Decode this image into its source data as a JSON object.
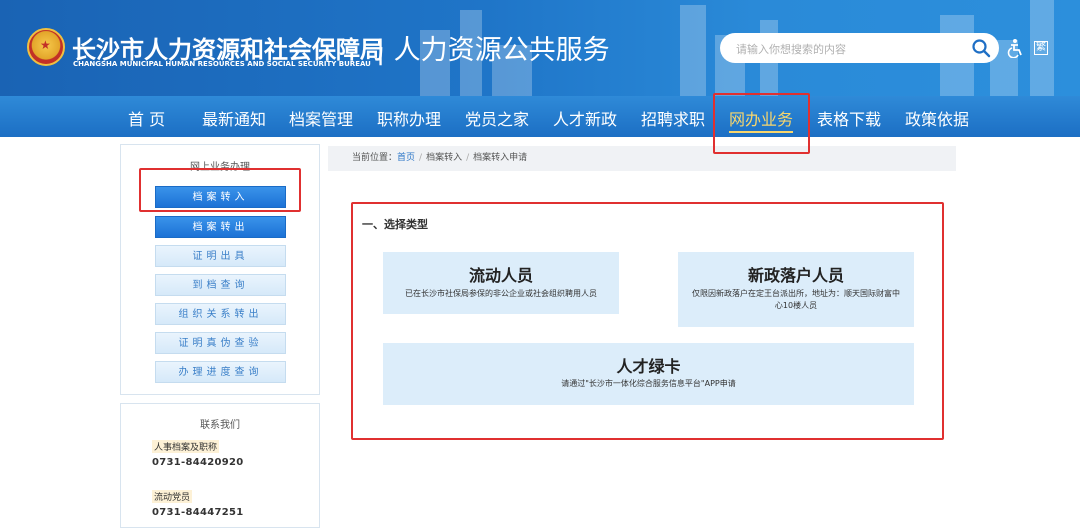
{
  "header": {
    "logo_cn": "长沙市人力资源和社会保障局",
    "logo_en": "CHANGSHA MUNICIPAL HUMAN RESOURCES AND SOCIAL SECURITY BUREAU",
    "subtitle": "| 人力资源公共服务",
    "search_placeholder": "请输入你想搜索的内容",
    "traditional_label": "繁"
  },
  "nav": {
    "items": [
      {
        "label": "首 页"
      },
      {
        "label": "最新通知"
      },
      {
        "label": "档案管理"
      },
      {
        "label": "职称办理"
      },
      {
        "label": "党员之家"
      },
      {
        "label": "人才新政"
      },
      {
        "label": "招聘求职"
      },
      {
        "label": "网办业务",
        "active": true
      },
      {
        "label": "表格下载"
      },
      {
        "label": "政策依据"
      }
    ]
  },
  "sidebar": {
    "online_title": "网上业务办理",
    "buttons": [
      {
        "label": "档案转入",
        "active": true
      },
      {
        "label": "档案转出",
        "active": true
      },
      {
        "label": "证明出具"
      },
      {
        "label": "到档查询"
      },
      {
        "label": "组织关系转出"
      },
      {
        "label": "证明真伪查验"
      },
      {
        "label": "办理进度查询"
      }
    ],
    "contact_title": "联系我们",
    "contacts": [
      {
        "label": "人事档案及职称",
        "phone": "0731-84420920"
      },
      {
        "label": "流动党员",
        "phone": "0731-84447251"
      }
    ]
  },
  "breadcrumb": {
    "prefix": "当前位置：",
    "home": "首页",
    "level1": "档案转入",
    "current": "档案转入申请"
  },
  "main": {
    "section_title": "一、选择类型",
    "cards": [
      {
        "title": "流动人员",
        "desc": "已在长沙市社保局参保的非公企业或社会组织聘用人员"
      },
      {
        "title": "新政落户人员",
        "desc": "仅限因新政落户在定王台派出所，地址为：顺天国际财富中心10楼人员"
      },
      {
        "title": "人才绿卡",
        "desc": "请通过\"长沙市一体化综合服务信息平台\"APP申请"
      }
    ]
  },
  "colors": {
    "header_blue": "#1f75c8",
    "nav_active": "#f7d66d",
    "card_bg": "#dcedfa",
    "annotation_red": "#e03030"
  }
}
